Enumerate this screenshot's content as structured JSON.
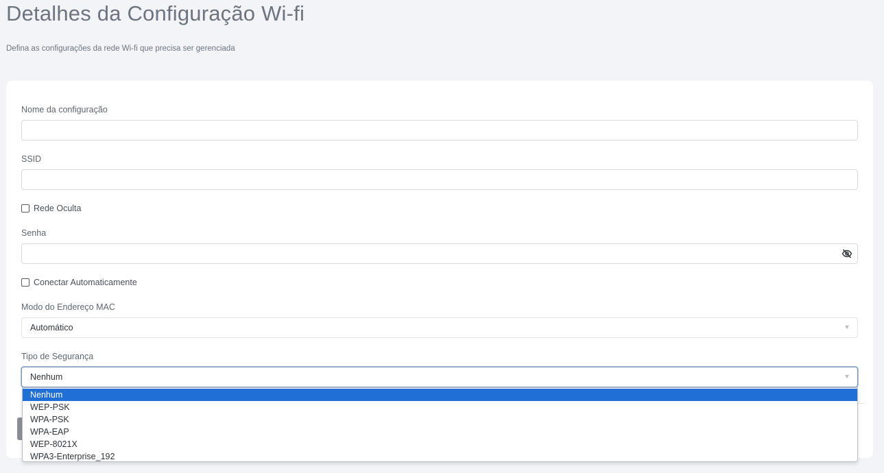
{
  "header": {
    "title": "Detalhes da Configuração Wi-fi",
    "subtitle": "Defina as configurações da rede Wi-fi que precisa ser gerenciada"
  },
  "form": {
    "config_name": {
      "label": "Nome da configuração",
      "value": ""
    },
    "ssid": {
      "label": "SSID",
      "value": ""
    },
    "hidden_network": {
      "label": "Rede Oculta",
      "checked": false
    },
    "password": {
      "label": "Senha",
      "value": "",
      "toggle_icon": "eye-slash-icon"
    },
    "auto_connect": {
      "label": "Conectar Automaticamente",
      "checked": false
    },
    "mac_mode": {
      "label": "Modo do Endereço MAC",
      "value": "Automático"
    },
    "security_type": {
      "label": "Tipo de Segurança",
      "value": "Nenhum",
      "options": [
        "Nenhum",
        "WEP-PSK",
        "WPA-PSK",
        "WPA-EAP",
        "WEP-8021X",
        "WPA3-Enterprise_192"
      ],
      "selected_index": 0
    }
  },
  "colors": {
    "background": "#f3f4f8",
    "card": "#ffffff",
    "option_highlight": "#1f6fd6",
    "focus_border": "#7e9ab8"
  }
}
